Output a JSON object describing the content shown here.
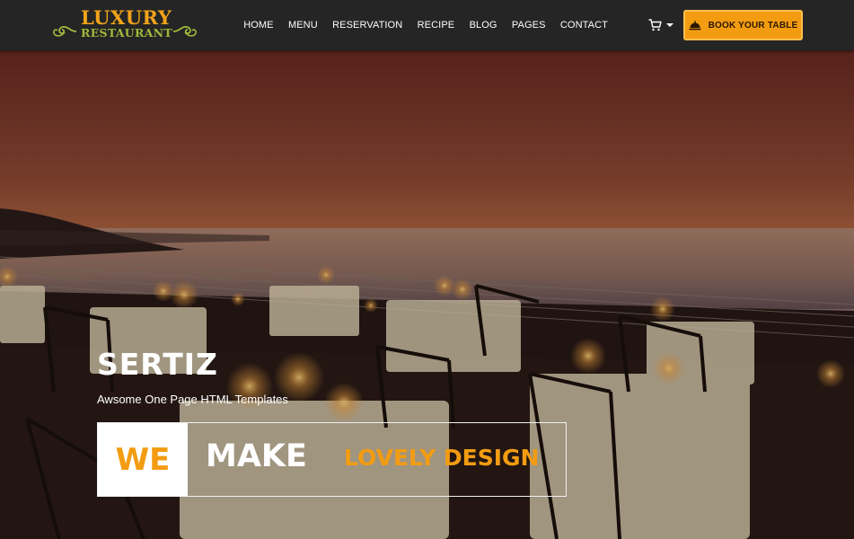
{
  "brand": {
    "line1": "LUXURY",
    "line2": "RESTAURANT",
    "color_primary": "#f2a31b",
    "color_secondary": "#9fb83c"
  },
  "nav": {
    "items": [
      {
        "label": "HOME"
      },
      {
        "label": "MENU"
      },
      {
        "label": "RESERVATION"
      },
      {
        "label": "RECIPE"
      },
      {
        "label": "BLOG"
      },
      {
        "label": "PAGES"
      },
      {
        "label": "CONTACT"
      }
    ],
    "cart_icon": "shopping-cart-icon",
    "book_button": {
      "label": "BOOK YOUR TABLE",
      "icon": "cloche-icon",
      "color": "#f39c12"
    }
  },
  "hero": {
    "title": "SERTIZ",
    "subtitle": "Awsome One Page HTML Templates",
    "box": {
      "we": "WE",
      "make": "MAKE",
      "lovely": "LOVELY DESIGN"
    },
    "accent": "#f39c12"
  }
}
